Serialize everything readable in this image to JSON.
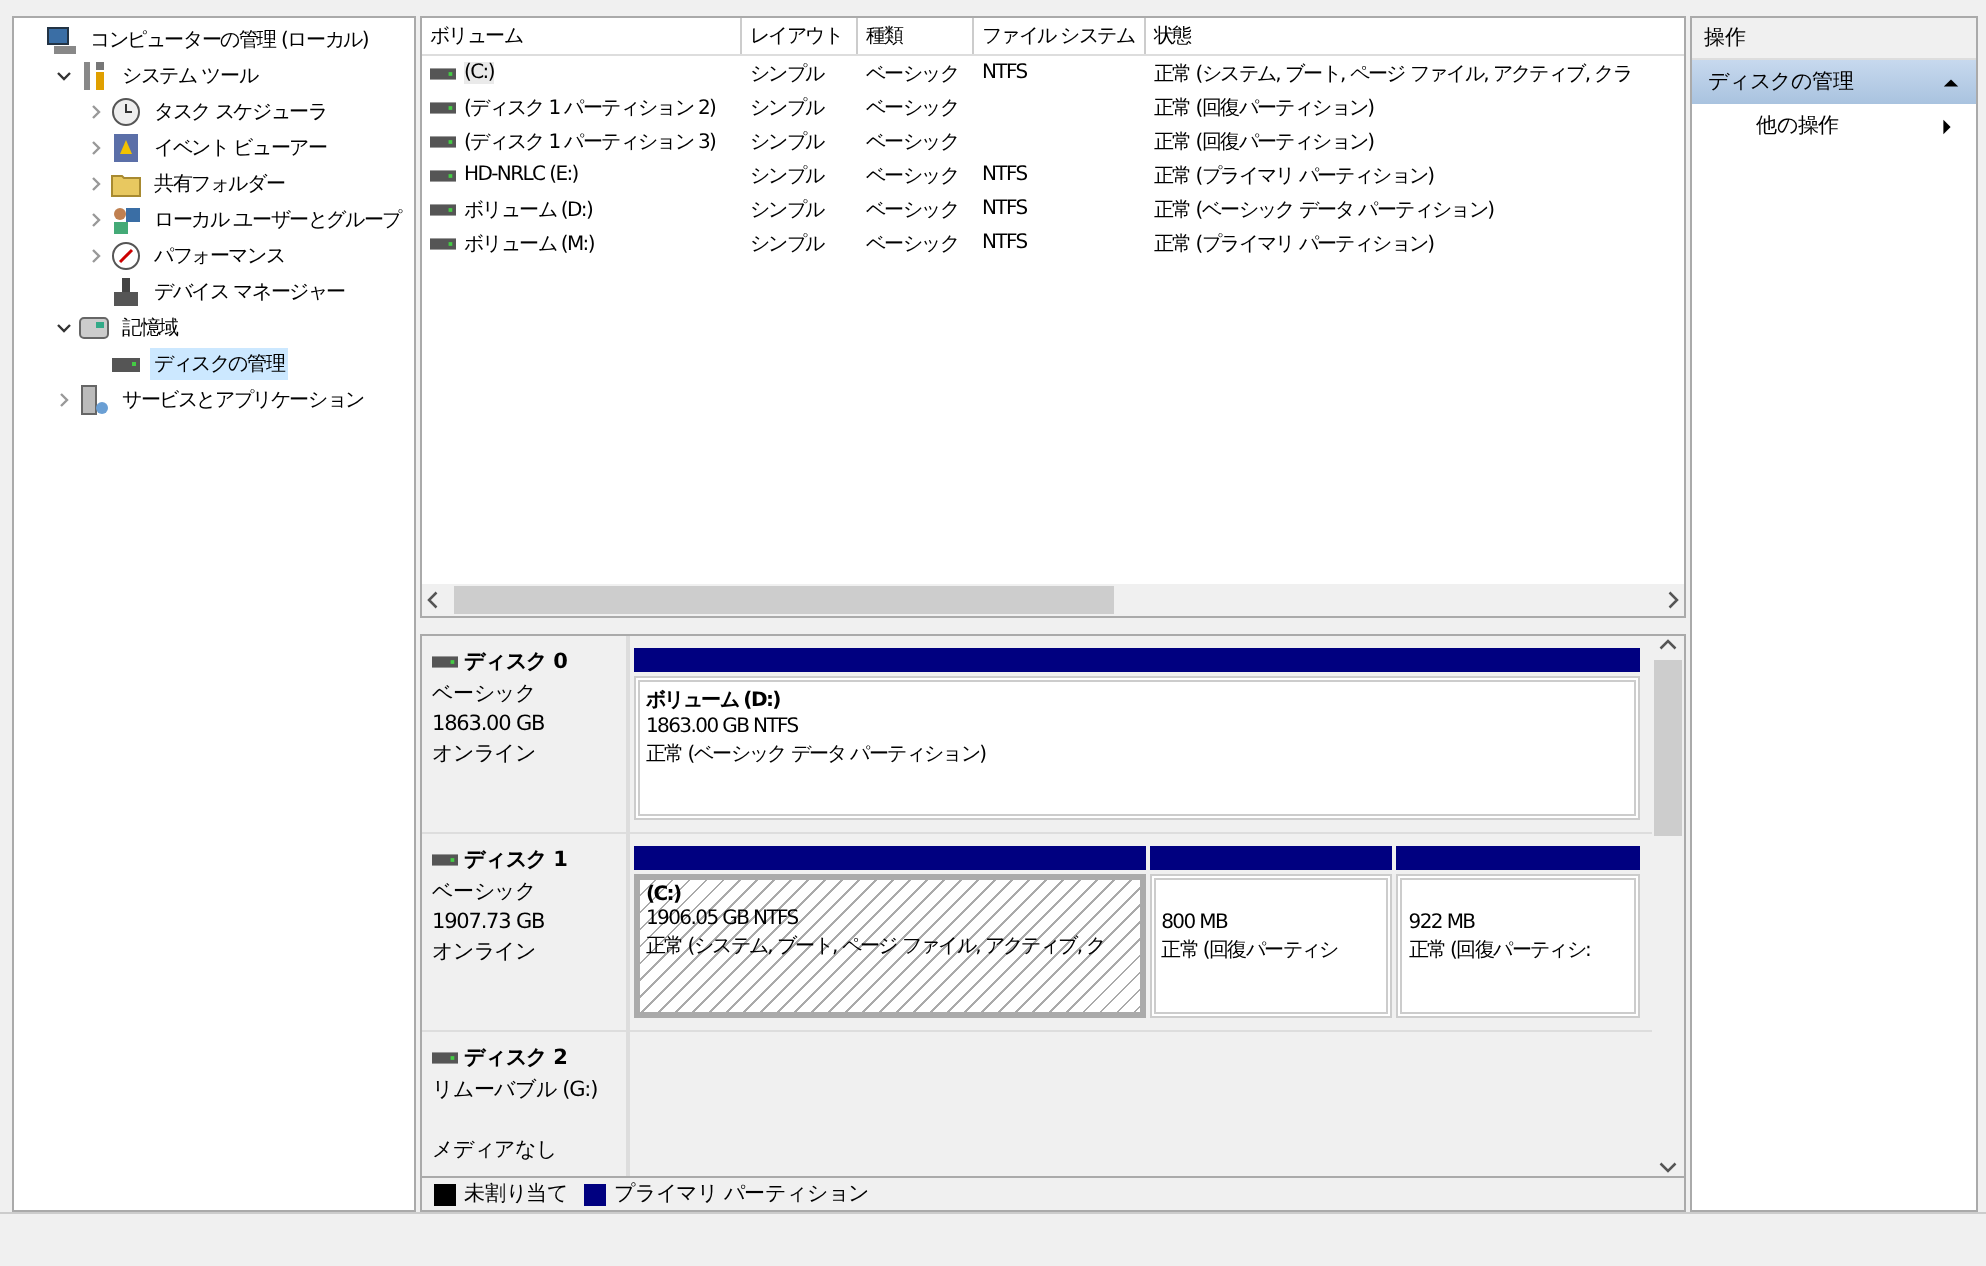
{
  "tree": [
    {
      "label": "コンピューターの管理 (ローカル)",
      "kind": "computer",
      "selected": false,
      "children": [
        {
          "label": "システム ツール",
          "kind": "tools",
          "expanded": true,
          "selected": false,
          "children": [
            {
              "label": "タスク スケジューラ",
              "kind": "clock",
              "expanded": false,
              "selected": false
            },
            {
              "label": "イベント ビューアー",
              "kind": "log",
              "expanded": false,
              "selected": false
            },
            {
              "label": "共有フォルダー",
              "kind": "folder",
              "expanded": false,
              "selected": false
            },
            {
              "label": "ローカル ユーザーとグループ",
              "kind": "users",
              "expanded": false,
              "selected": false
            },
            {
              "label": "パフォーマンス",
              "kind": "gauge",
              "expanded": false,
              "selected": false
            },
            {
              "label": "デバイス マネージャー",
              "kind": "device",
              "selected": false
            }
          ]
        },
        {
          "label": "記憶域",
          "kind": "storage",
          "expanded": true,
          "selected": false,
          "children": [
            {
              "label": "ディスクの管理",
              "kind": "disk",
              "selected": true
            }
          ]
        },
        {
          "label": "サービスとアプリケーション",
          "kind": "services",
          "expanded": false,
          "selected": false
        }
      ]
    }
  ],
  "volumes": {
    "columns": [
      "ボリューム",
      "レイアウト",
      "種類",
      "ファイル システム",
      "状態"
    ],
    "rows": [
      {
        "selected": true,
        "cells": [
          "(C:)",
          "シンプル",
          "ベーシック",
          "NTFS",
          "正常 (システム, ブート, ページ ファイル, アクティブ, クラ"
        ]
      },
      {
        "selected": false,
        "cells": [
          "(ディスク 1 パーティション 2)",
          "シンプル",
          "ベーシック",
          "",
          "正常 (回復パーティション)"
        ]
      },
      {
        "selected": false,
        "cells": [
          "(ディスク 1 パーティション 3)",
          "シンプル",
          "ベーシック",
          "",
          "正常 (回復パーティション)"
        ]
      },
      {
        "selected": false,
        "cells": [
          "HD-NRLC (E:)",
          "シンプル",
          "ベーシック",
          "NTFS",
          "正常 (プライマリ パーティション)"
        ]
      },
      {
        "selected": false,
        "cells": [
          "ボリューム (D:)",
          "シンプル",
          "ベーシック",
          "NTFS",
          "正常 (ベーシック データ パーティション)"
        ]
      },
      {
        "selected": false,
        "cells": [
          "ボリューム (M:)",
          "シンプル",
          "ベーシック",
          "NTFS",
          "正常 (プライマリ パーティション)"
        ]
      }
    ]
  },
  "disks": [
    {
      "name": "ディスク 0",
      "type": "ベーシック",
      "size": "1863.00 GB",
      "status": "オンライン",
      "partitions": [
        {
          "name": "ボリューム  (D:)",
          "size_fs": "1863.00 GB NTFS",
          "status": "正常 (ベーシック データ パーティション)",
          "kind": "primary",
          "selected": false
        }
      ]
    },
    {
      "name": "ディスク 1",
      "type": "ベーシック",
      "size": "1907.73 GB",
      "status": "オンライン",
      "partitions": [
        {
          "name": "(C:)",
          "size_fs": "1906.05 GB NTFS",
          "status": "正常 (システム, ブート, ページ ファイル, アクティブ, ク",
          "kind": "primary",
          "selected": true
        },
        {
          "size_fs": "800 MB",
          "status": "正常 (回復パーティシ",
          "kind": "primary",
          "selected": false
        },
        {
          "size_fs": "922 MB",
          "status": "正常 (回復パーティシ:",
          "kind": "primary",
          "selected": false
        }
      ]
    },
    {
      "name": "ディスク 2",
      "type": "リムーバブル (G:)",
      "status": "メディアなし"
    }
  ],
  "legend": [
    {
      "label": "未割り当て",
      "color": "#000000"
    },
    {
      "label": "プライマリ パーティション",
      "color": "#000080"
    }
  ],
  "actions": {
    "title": "操作",
    "section": {
      "label": "ディスクの管理",
      "expanded": true
    },
    "items": [
      {
        "label": "他の操作"
      }
    ]
  }
}
